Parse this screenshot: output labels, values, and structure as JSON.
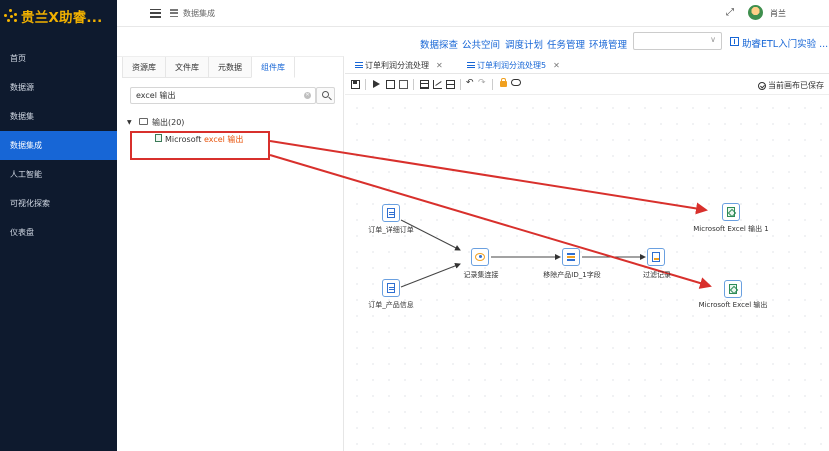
{
  "app": {
    "title": "贵兰X助睿..."
  },
  "sidebar": {
    "items": [
      {
        "label": "首页",
        "active": false
      },
      {
        "label": "数据源",
        "active": false
      },
      {
        "label": "数据集",
        "active": false
      },
      {
        "label": "数据集成",
        "active": true
      },
      {
        "label": "人工智能",
        "active": false
      },
      {
        "label": "可视化探索",
        "active": false
      },
      {
        "label": "仪表盘",
        "active": false
      }
    ]
  },
  "header": {
    "breadcrumb": "数据集成",
    "username": "肖兰",
    "expand_icon": "expand-icon"
  },
  "toolbar": {
    "links": [
      "数据探查",
      "公共空间",
      "调度计划",
      "任务管理",
      "环境管理"
    ],
    "select_value": "",
    "guide_link": "助睿ETL入门实验 ..."
  },
  "library": {
    "tabs": [
      {
        "label": "资源库",
        "active": false
      },
      {
        "label": "文件库",
        "active": false
      },
      {
        "label": "元数据",
        "active": false
      },
      {
        "label": "组件库",
        "active": true
      }
    ],
    "search_value": "excel 输出",
    "folder_label": "输出(20)",
    "leaf_prefix": "Microsoft ",
    "leaf_highlight": "excel 输出"
  },
  "canvas": {
    "tabs": [
      {
        "label": "订单利润分流处理",
        "active": false
      },
      {
        "label": "订单利润分流处理5",
        "active": true
      }
    ],
    "saved_status": "当前画布已保存",
    "nodes": [
      {
        "id": "n1",
        "label": "订单_详细订单",
        "icon": "input-table-icon"
      },
      {
        "id": "n2",
        "label": "订单_产品信息",
        "icon": "input-table-icon"
      },
      {
        "id": "n3",
        "label": "记录集连接",
        "icon": "join-icon"
      },
      {
        "id": "n4",
        "label": "移除产品ID_1字段",
        "icon": "remove-field-icon"
      },
      {
        "id": "n5",
        "label": "过滤记录",
        "icon": "filter-icon"
      },
      {
        "id": "n6",
        "label": "Microsoft Excel 输出 1",
        "icon": "excel-output-icon"
      },
      {
        "id": "n7",
        "label": "Microsoft Excel 输出",
        "icon": "excel-output-icon"
      }
    ]
  },
  "colors": {
    "sidebar_bg": "#0e1a2e",
    "active_blue": "#1766d6",
    "logo_gold": "#f0b000",
    "annotation_red": "#d8302c",
    "highlight_orange": "#e8540c"
  }
}
